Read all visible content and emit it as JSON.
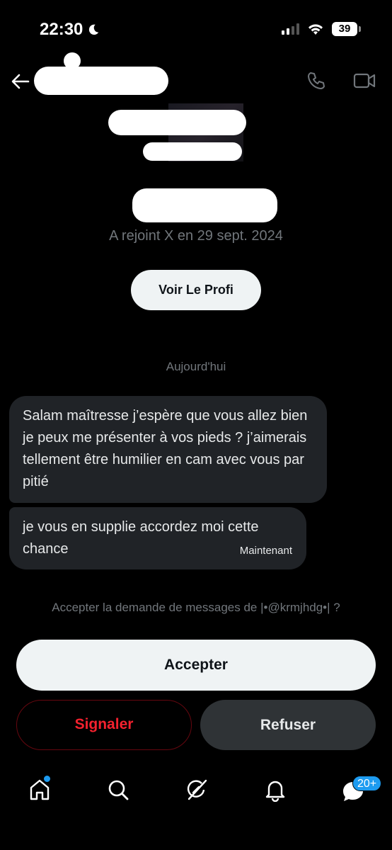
{
  "status_bar": {
    "time": "22:30",
    "battery": "39"
  },
  "profile": {
    "joined": "A rejoint X en 29 sept. 2024",
    "view_profile_label": "Voir Le Profi"
  },
  "conversation": {
    "date_separator": "Aujourd'hui",
    "messages": [
      {
        "text": "Salam maîtresse j’espère que vous allez bien je peux me présenter à vos pieds ? j’aimerais tellement être humilier en cam avec vous par pitié"
      },
      {
        "text": "je vous en supplie accordez moi cette chance",
        "time": "Maintenant"
      }
    ]
  },
  "request": {
    "prompt": "Accepter la demande de messages de |•@krmjhdg•| ?",
    "accept_label": "Accepter",
    "report_label": "Signaler",
    "refuse_label": "Refuser"
  },
  "nav": {
    "messages_badge": "20+"
  },
  "colors": {
    "accent": "#1d9bf0",
    "danger": "#f4212e",
    "background": "#000000"
  },
  "icons": [
    "moon-icon",
    "signal-icon",
    "wifi-icon",
    "back-arrow-icon",
    "phone-icon",
    "video-icon",
    "home-icon",
    "search-icon",
    "grok-icon",
    "bell-icon",
    "messages-icon"
  ]
}
